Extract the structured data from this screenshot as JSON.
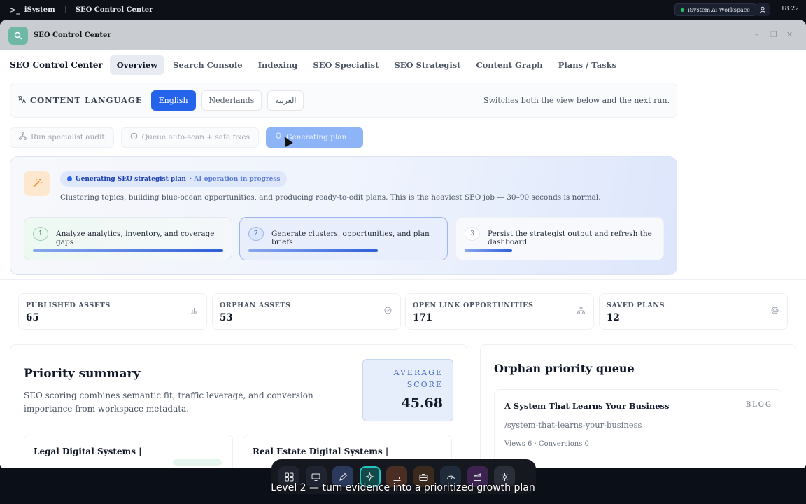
{
  "topbar": {
    "logo": ">_",
    "brand": "iSystem",
    "app_title": "SEO Control Center",
    "workspace": "iSystem.ai Workspace",
    "user_icon": "user-icon",
    "clock": "18:22"
  },
  "window": {
    "title": "SEO Control Center",
    "icon": "search-icon",
    "controls": {
      "minimize": "–",
      "maximize": "❐",
      "close": "✕"
    }
  },
  "tabs": {
    "app_title": "SEO Control Center",
    "items": [
      {
        "label": "Overview",
        "active": true
      },
      {
        "label": "Search Console"
      },
      {
        "label": "Indexing"
      },
      {
        "label": "SEO Specialist"
      },
      {
        "label": "SEO Strategist"
      },
      {
        "label": "Content Graph"
      },
      {
        "label": "Plans / Tasks"
      }
    ]
  },
  "language": {
    "label": "CONTENT LANGUAGE",
    "options": [
      "English",
      "Nederlands",
      "العربية"
    ],
    "selected": "English",
    "note": "Switches both the view below and the next run."
  },
  "actions": {
    "audit": "Run specialist audit",
    "queue": "Queue auto-scan + safe fixes",
    "generating": "Generating plan…"
  },
  "generation": {
    "title": "Generating SEO strategist plan",
    "subtitle": "· AI operation in progress",
    "description": "Clustering topics, building blue-ocean opportunities, and producing ready-to-edit plans. This is the heaviest SEO job — 30–90 seconds is normal.",
    "steps": [
      {
        "num": "1",
        "label": "Analyze analytics, inventory, and coverage gaps",
        "progress": 1.0
      },
      {
        "num": "2",
        "label": "Generate clusters, opportunities, and plan briefs",
        "progress": 0.68
      },
      {
        "num": "3",
        "label": "Persist the strategist output and refresh the dashboard",
        "progress": 0.25
      }
    ]
  },
  "stats": [
    {
      "label": "PUBLISHED ASSETS",
      "value": "65",
      "icon": "bar-chart-icon"
    },
    {
      "label": "ORPHAN ASSETS",
      "value": "53",
      "icon": "check-circle-icon"
    },
    {
      "label": "OPEN LINK OPPORTUNITIES",
      "value": "171",
      "icon": "network-icon"
    },
    {
      "label": "SAVED PLANS",
      "value": "12",
      "icon": "target-icon"
    }
  ],
  "priority": {
    "title": "Priority summary",
    "description": "SEO scoring combines semantic fit, traffic leverage, and conversion importance from workspace metadata.",
    "average_label": "AVERAGE SCORE",
    "average_value": "45.68",
    "cards": [
      {
        "title": "Legal Digital Systems |"
      },
      {
        "title": "Real Estate Digital Systems |"
      }
    ]
  },
  "orphan": {
    "title": "Orphan priority queue",
    "items": [
      {
        "title": "A System That Learns Your Business",
        "tag": "BLOG",
        "path": "/system-that-learns-your-business",
        "meta": "Views 6 · Conversions 0"
      }
    ]
  },
  "dock": [
    "grid-icon",
    "monitor-icon",
    "pen-icon",
    "sparkle-icon",
    "chart-icon",
    "briefcase-icon",
    "gauge-icon",
    "clapper-icon",
    "settings-icon"
  ],
  "caption": "Level 2 — turn evidence into a prioritized growth plan"
}
